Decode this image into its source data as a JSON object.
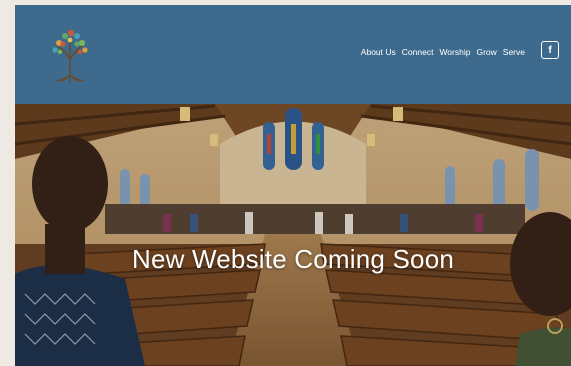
{
  "header": {
    "nav": [
      "About Us",
      "Connect",
      "Worship",
      "Grow",
      "Serve"
    ],
    "social_icon": "facebook-icon",
    "social_glyph": "f",
    "logo_icon": "tree-of-life-logo-icon"
  },
  "hero": {
    "headline": "New Website Coming Soon"
  },
  "colors": {
    "header_bg": "#3e6b8d",
    "page_bg": "#eeeae3",
    "text": "#ffffff"
  }
}
